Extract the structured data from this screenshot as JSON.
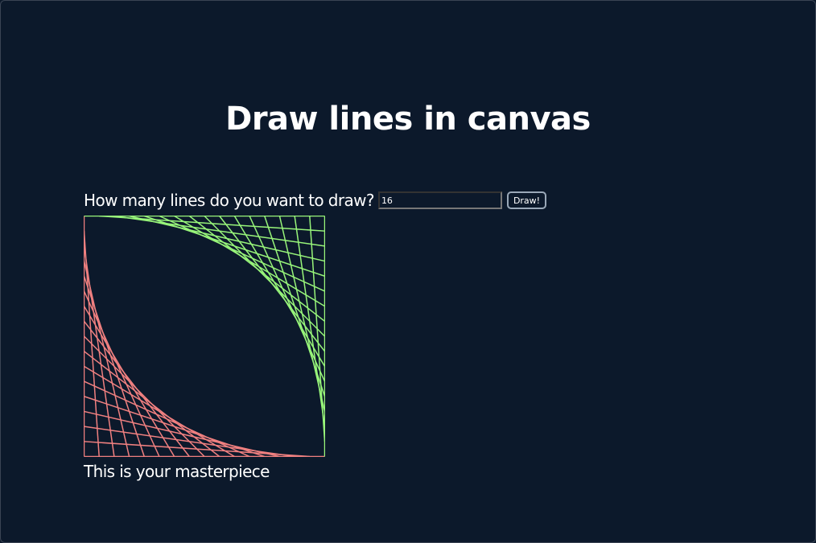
{
  "title": "Draw lines in canvas",
  "form": {
    "label": "How many lines do you want to draw?",
    "value": "16",
    "button_label": "Draw!"
  },
  "canvas": {
    "line_count": 16,
    "colors": {
      "lower_left": "#f08080",
      "upper_right": "#98f57a"
    }
  },
  "caption": "This is your masterpiece"
}
